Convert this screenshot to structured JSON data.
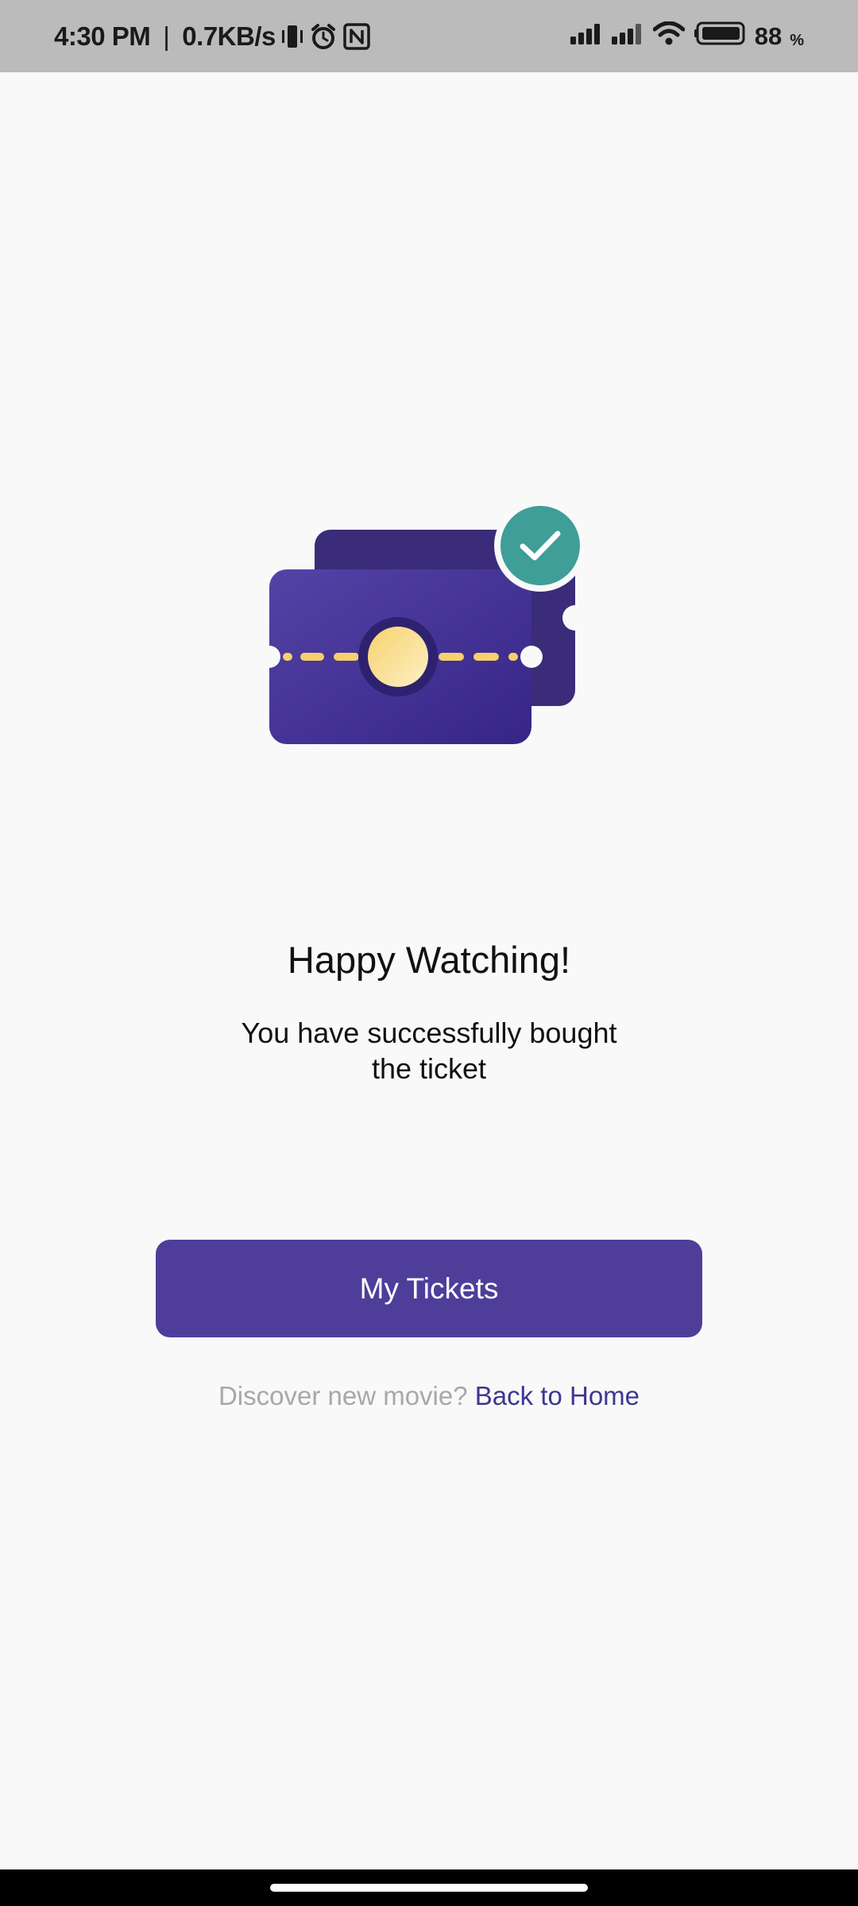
{
  "status_bar": {
    "time": "4:30 PM",
    "separator": "|",
    "network_speed": "0.7KB/s",
    "battery_level": "88",
    "battery_unit": "%",
    "icons": [
      "vibrate-icon",
      "alarm-icon",
      "nfc-icon",
      "signal-icon",
      "signal-icon",
      "wifi-icon",
      "battery-icon"
    ]
  },
  "illustration": {
    "icon": "ticket-success-icon",
    "colors": {
      "ticket_front": "#4e3e9a",
      "ticket_back": "#3a2c78",
      "perforation": "#f5d06b",
      "check_badge": "#3f9e97"
    }
  },
  "message": {
    "title": "Happy Watching!",
    "subtitle": "You have successfully bought the ticket"
  },
  "actions": {
    "my_tickets_label": "My Tickets",
    "discover_prompt": "Discover new movie?",
    "back_home_label": "Back to Home"
  },
  "colors": {
    "accent": "#4e3e9a",
    "link": "#3f3692",
    "muted_text": "#a8a8a8",
    "background": "#f9f9f9"
  }
}
